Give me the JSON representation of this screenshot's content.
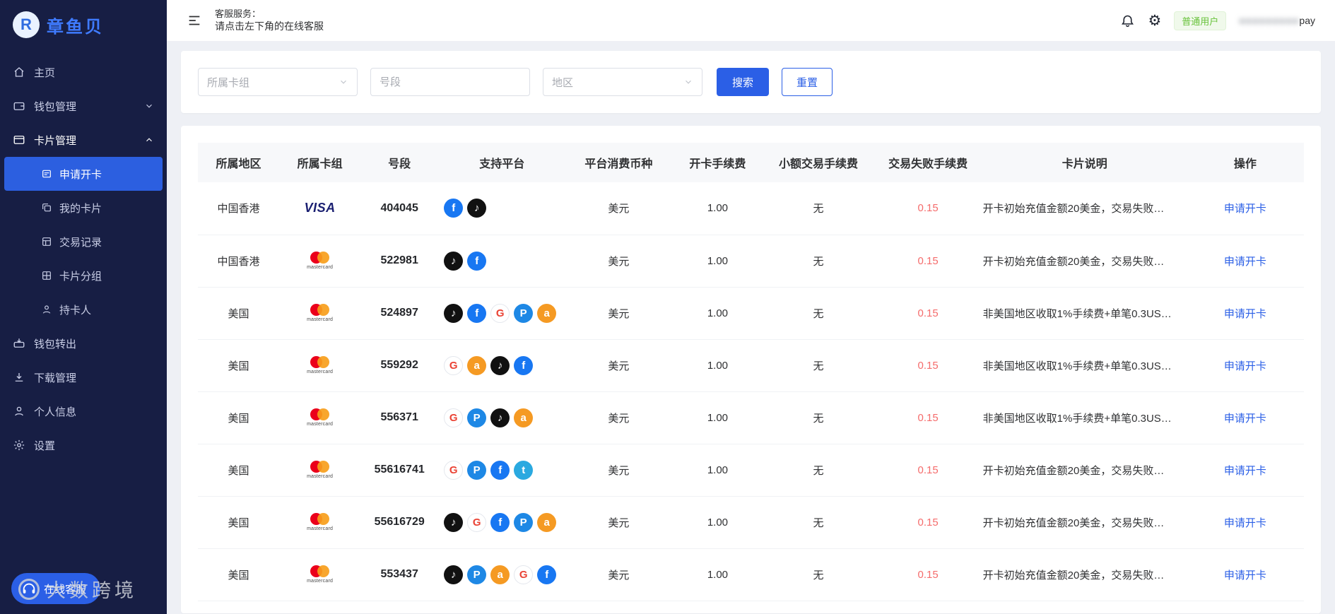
{
  "colors": {
    "primary": "#2b5fe6",
    "sidebar_bg": "#171e44",
    "danger": "#f56c6c",
    "success": "#67c23a"
  },
  "app": {
    "logo_text": "章鱼贝",
    "logo_glyph": "R"
  },
  "sidebar": {
    "items": [
      {
        "label": "主页"
      },
      {
        "label": "钱包管理"
      },
      {
        "label": "卡片管理"
      },
      {
        "label": "钱包转出"
      },
      {
        "label": "下载管理"
      },
      {
        "label": "个人信息"
      },
      {
        "label": "设置"
      }
    ],
    "card_submenu": [
      {
        "label": "申请开卡",
        "active": true
      },
      {
        "label": "我的卡片"
      },
      {
        "label": "交易记录"
      },
      {
        "label": "卡片分组"
      },
      {
        "label": "持卡人"
      }
    ],
    "service_button": "在线客服",
    "watermark": "大数跨境"
  },
  "header": {
    "service_label": "客服服务：",
    "service_hint": "请点击左下角的在线客服",
    "user_badge": "普通用户",
    "user_masked": "●●●●●●●●●",
    "user_suffix": "pay"
  },
  "filters": {
    "card_group_placeholder": "所属卡组",
    "bin_placeholder": "号段",
    "region_placeholder": "地区",
    "search_label": "搜索",
    "reset_label": "重置"
  },
  "brands": {
    "visa": {
      "label": "VISA"
    },
    "mastercard": {
      "label": "mastercard"
    }
  },
  "platform_styles": {
    "facebook": {
      "bg": "#1877f2",
      "glyph": "f"
    },
    "tiktok": {
      "bg": "#111111",
      "glyph": "♪"
    },
    "google": {
      "bg": "#ffffff",
      "glyph": "G",
      "color": "#ea4335",
      "border": "#e4e7ed"
    },
    "paypal": {
      "bg": "#1e88e5",
      "glyph": "P"
    },
    "amazon": {
      "bg": "#f59a23",
      "glyph": "a"
    },
    "twitter": {
      "bg": "#2aa9e0",
      "glyph": "t"
    }
  },
  "table": {
    "columns": [
      "所属地区",
      "所属卡组",
      "号段",
      "支持平台",
      "平台消费币种",
      "开卡手续费",
      "小额交易手续费",
      "交易失败手续费",
      "卡片说明",
      "操作"
    ],
    "rows": [
      {
        "region": "中国香港",
        "brand": "visa",
        "bin": "404045",
        "platforms": [
          "facebook",
          "tiktok"
        ],
        "currency": "美元",
        "open_fee": "1.00",
        "small_fee": "无",
        "fail_fee": "0.15",
        "desc": "开卡初始充值金额20美金，交易失败…",
        "action": "申请开卡"
      },
      {
        "region": "中国香港",
        "brand": "mastercard",
        "bin": "522981",
        "platforms": [
          "tiktok",
          "facebook"
        ],
        "currency": "美元",
        "open_fee": "1.00",
        "small_fee": "无",
        "fail_fee": "0.15",
        "desc": "开卡初始充值金额20美金，交易失败…",
        "action": "申请开卡"
      },
      {
        "region": "美国",
        "brand": "mastercard",
        "bin": "524897",
        "platforms": [
          "tiktok",
          "facebook",
          "google",
          "paypal",
          "amazon"
        ],
        "currency": "美元",
        "open_fee": "1.00",
        "small_fee": "无",
        "fail_fee": "0.15",
        "desc": "非美国地区收取1%手续费+单笔0.3US…",
        "action": "申请开卡"
      },
      {
        "region": "美国",
        "brand": "mastercard",
        "bin": "559292",
        "platforms": [
          "google",
          "amazon",
          "tiktok",
          "facebook"
        ],
        "currency": "美元",
        "open_fee": "1.00",
        "small_fee": "无",
        "fail_fee": "0.15",
        "desc": "非美国地区收取1%手续费+单笔0.3US…",
        "action": "申请开卡"
      },
      {
        "region": "美国",
        "brand": "mastercard",
        "bin": "556371",
        "platforms": [
          "google",
          "paypal",
          "tiktok",
          "amazon"
        ],
        "currency": "美元",
        "open_fee": "1.00",
        "small_fee": "无",
        "fail_fee": "0.15",
        "desc": "非美国地区收取1%手续费+单笔0.3US…",
        "action": "申请开卡"
      },
      {
        "region": "美国",
        "brand": "mastercard",
        "bin": "55616741",
        "platforms": [
          "google",
          "paypal",
          "facebook",
          "twitter"
        ],
        "currency": "美元",
        "open_fee": "1.00",
        "small_fee": "无",
        "fail_fee": "0.15",
        "desc": "开卡初始充值金额20美金，交易失败…",
        "action": "申请开卡"
      },
      {
        "region": "美国",
        "brand": "mastercard",
        "bin": "55616729",
        "platforms": [
          "tiktok",
          "google",
          "facebook",
          "paypal",
          "amazon"
        ],
        "currency": "美元",
        "open_fee": "1.00",
        "small_fee": "无",
        "fail_fee": "0.15",
        "desc": "开卡初始充值金额20美金，交易失败…",
        "action": "申请开卡"
      },
      {
        "region": "美国",
        "brand": "mastercard",
        "bin": "553437",
        "platforms": [
          "tiktok",
          "paypal",
          "amazon",
          "google",
          "facebook"
        ],
        "currency": "美元",
        "open_fee": "1.00",
        "small_fee": "无",
        "fail_fee": "0.15",
        "desc": "开卡初始充值金额20美金，交易失败…",
        "action": "申请开卡"
      }
    ]
  }
}
